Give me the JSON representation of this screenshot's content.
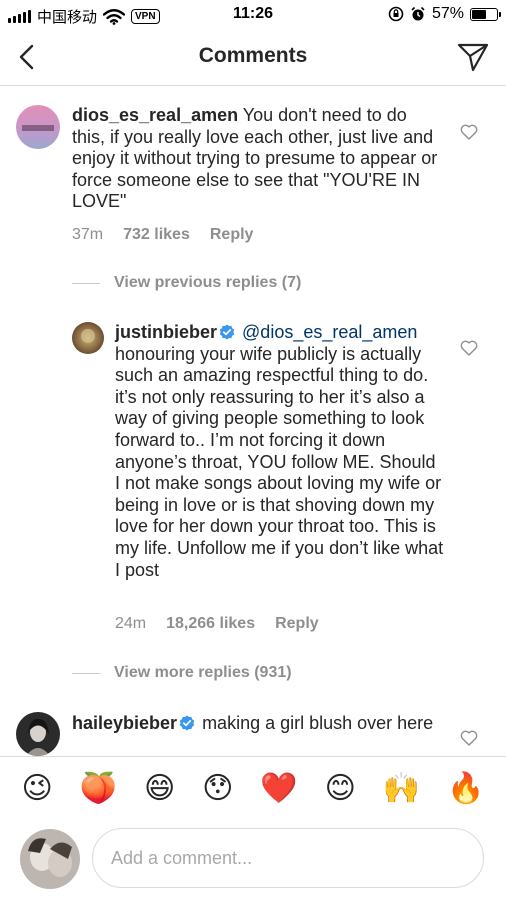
{
  "status_bar": {
    "carrier": "中国移动",
    "vpn": "VPN",
    "time": "11:26",
    "battery": "57%",
    "battery_level": 0.57
  },
  "header": {
    "title": "Comments",
    "back_icon": "chevron-left-icon",
    "send_icon": "paper-plane-icon"
  },
  "comments": [
    {
      "username": "dios_es_real_amen",
      "text": "You don't need to do this, if you really love each other, just live and enjoy it without trying to presume to appear or force someone else to see that \"YOU'RE IN LOVE\"",
      "time": "37m",
      "likes": "732 likes",
      "reply": "Reply"
    }
  ],
  "view_previous": "View previous replies (7)",
  "reply": {
    "username": "justinbieber",
    "mention": "@dios_es_real_amen",
    "text": "honouring your wife publicly is actually such an amazing respectful thing to do.  it’s not only reassuring to her it’s also a way of giving people something to look forward to.. I’m not forcing it down anyone’s throat, YOU follow ME. Should I not make songs about loving my wife or being in love or is that shoving down my love for her down your throat too. This is my life. Unfollow me if you don’t like what I post",
    "time": "24m",
    "likes": "18,266 likes",
    "reply": "Reply"
  },
  "view_more": "View more replies (931)",
  "last_comment": {
    "username": "haileybieber",
    "text": "making a girl blush over here"
  },
  "emojis": [
    "😉",
    "🍑",
    "😄",
    "😯",
    "❤️",
    "😊",
    "🙌",
    "🔥"
  ],
  "composer": {
    "placeholder": "Add a comment..."
  },
  "colors": {
    "text": "#262626",
    "secondary": "#8e8e8e",
    "verified": "#3897f0",
    "mention": "#003569"
  }
}
